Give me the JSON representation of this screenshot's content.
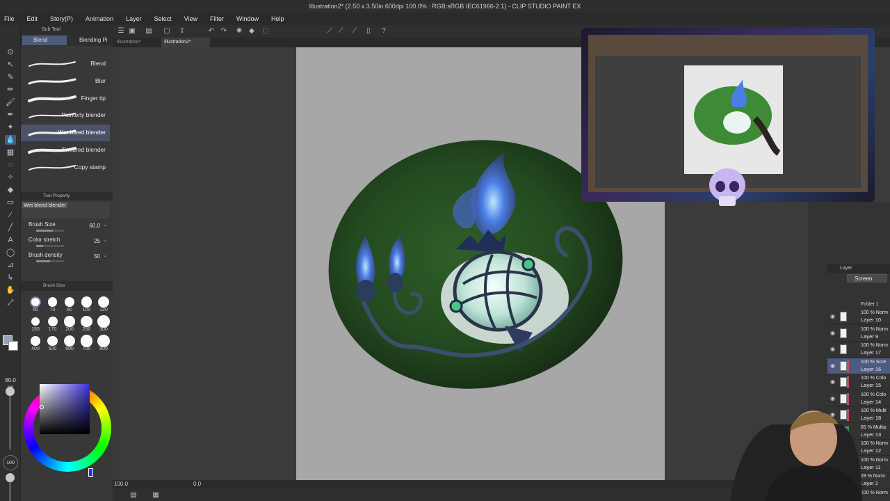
{
  "window": {
    "title": "Illustration2* (2.50 x 3.50in 600dpi 100.0% : RGB:sRGB IEC61966-2.1) - CLIP STUDIO PAINT EX"
  },
  "menu": [
    "File",
    "Edit",
    "Story(P)",
    "Animation",
    "Layer",
    "Select",
    "View",
    "Filter",
    "Window",
    "Help"
  ],
  "doc_tabs": [
    {
      "label": "Illustration*",
      "active": false
    },
    {
      "label": "Illustration2*",
      "active": true
    }
  ],
  "sub_tool": {
    "header": "Sub Tool",
    "tabs": [
      "Blend",
      "Blending Pi"
    ],
    "brushes": [
      {
        "label": "Blend",
        "selected": false
      },
      {
        "label": "Blur",
        "selected": false
      },
      {
        "label": "Finger tip",
        "selected": false
      },
      {
        "label": "Painterly blender",
        "selected": false
      },
      {
        "label": "Wet bleed blender",
        "selected": true
      },
      {
        "label": "Textured blender",
        "selected": false
      },
      {
        "label": "Copy stamp",
        "selected": false
      }
    ]
  },
  "tool_property": {
    "header": "Tool Property",
    "preset_name": "Wet bleed blender",
    "properties": [
      {
        "label": "Brush Size",
        "value": "60.0",
        "fill": 0.6
      },
      {
        "label": "Color stretch",
        "value": "25",
        "fill": 0.25
      },
      {
        "label": "Brush density",
        "value": "50",
        "fill": 0.5
      }
    ]
  },
  "brush_size_palette": {
    "header": "Brush Size",
    "sizes": [
      "60",
      "70",
      "80",
      "100",
      "120",
      "150",
      "170",
      "200",
      "250",
      "300",
      "400",
      "500",
      "600",
      "700",
      "800"
    ],
    "selected": "60"
  },
  "tool_readouts": {
    "size_value": "60.0",
    "size_unit": "px",
    "opacity": "100"
  },
  "color": {
    "main": "#9aa3b8",
    "sub": "#ffffff",
    "hue": "#2233ff"
  },
  "status": {
    "zoom": "100.0",
    "angle": "0.0"
  },
  "layers": {
    "header": "Layer",
    "blend_mode": "Screen",
    "partial_top": "Folder 1",
    "items": [
      {
        "mode": "100 % Norm",
        "name": "Layer 10",
        "tag": "",
        "selected": false
      },
      {
        "mode": "100 % Norm",
        "name": "Layer 9",
        "tag": "",
        "selected": false
      },
      {
        "mode": "100 % Norm",
        "name": "Layer 17",
        "tag": "",
        "selected": false
      },
      {
        "mode": "100 % Scre",
        "name": "Layer 16",
        "tag": "#c24a6a",
        "selected": true
      },
      {
        "mode": "100 % Colo",
        "name": "Layer 15",
        "tag": "#c24a6a",
        "selected": false
      },
      {
        "mode": "100 % Colo",
        "name": "Layer 14",
        "tag": "#c24a6a",
        "selected": false
      },
      {
        "mode": "100 % Multi",
        "name": "Layer 18",
        "tag": "#c24a6a",
        "selected": false
      },
      {
        "mode": "65 % Multip",
        "name": "Layer 13",
        "tag": "#3a8a4a",
        "selected": false
      },
      {
        "mode": "100 % Norm",
        "name": "Layer 12",
        "tag": "",
        "selected": false
      },
      {
        "mode": "100 % Norm",
        "name": "Layer 11",
        "tag": "",
        "selected": false
      },
      {
        "mode": "28 % Norm",
        "name": "Layer 2",
        "tag": "",
        "selected": false
      },
      {
        "mode": "100 % Norm",
        "name": "",
        "tag": "",
        "selected": false
      }
    ]
  }
}
